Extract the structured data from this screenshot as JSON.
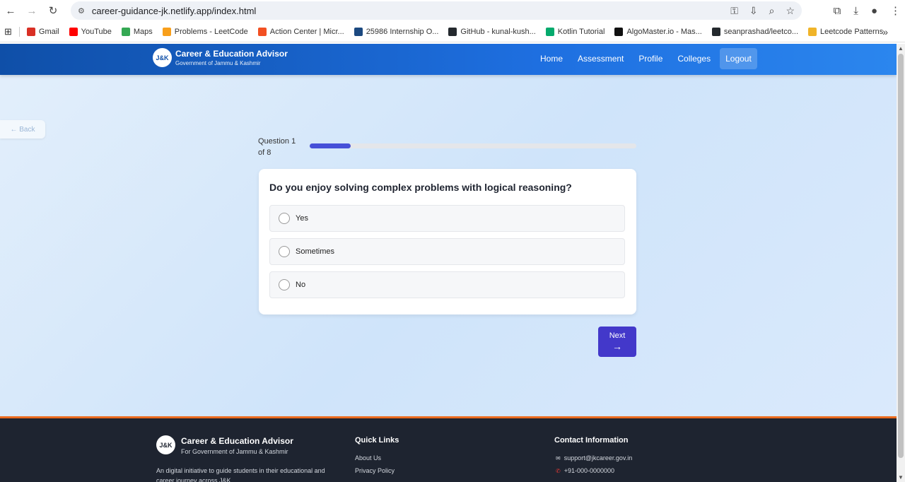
{
  "browser": {
    "url": "career-guidance-jk.netlify.app/index.html",
    "bookmarks": [
      {
        "label": "Gmail",
        "icon": "gmail-icon",
        "color": "#d93025"
      },
      {
        "label": "YouTube",
        "icon": "youtube-icon",
        "color": "#ff0000"
      },
      {
        "label": "Maps",
        "icon": "maps-icon",
        "color": "#34a853"
      },
      {
        "label": "Problems - LeetCode",
        "icon": "leetcode-icon",
        "color": "#f89f1b"
      },
      {
        "label": "Action Center | Micr...",
        "icon": "microsoft-icon",
        "color": "#f25022"
      },
      {
        "label": "25986 Internship O...",
        "icon": "unstop-icon",
        "color": "#1c4980"
      },
      {
        "label": "GitHub - kunal-kush...",
        "icon": "github-icon",
        "color": "#24292e"
      },
      {
        "label": "Kotlin Tutorial",
        "icon": "w3schools-icon",
        "color": "#04aa6d"
      },
      {
        "label": "AlgoMaster.io - Mas...",
        "icon": "algomaster-icon",
        "color": "#111111"
      },
      {
        "label": "seanprashad/leetco...",
        "icon": "github-icon",
        "color": "#24292e"
      },
      {
        "label": "Leetcode Patterns",
        "icon": "leetcode-patterns-icon",
        "color": "#f0b429"
      }
    ]
  },
  "header": {
    "logo_text": "J&K",
    "title": "Career & Education Advisor",
    "subtitle": "Government of Jammu & Kashmir",
    "nav": [
      "Home",
      "Assessment",
      "Profile",
      "Colleges",
      "Logout"
    ]
  },
  "back_label": "← Back",
  "quiz": {
    "progress_label": "Question 1 of 8",
    "progress_fraction": 0.125,
    "question": "Do you enjoy solving complex problems with logical reasoning?",
    "options": [
      "Yes",
      "Sometimes",
      "No"
    ],
    "next_label": "Next",
    "next_arrow": "→"
  },
  "footer": {
    "logo_text": "J&K",
    "title": "Career & Education Advisor",
    "subtitle": "For Government of Jammu & Kashmir",
    "description": "An digital initiative to guide students in their educational and career journey across J&K",
    "quick_links_title": "Quick Links",
    "quick_links": [
      "About Us",
      "Privacy Policy"
    ],
    "contact_title": "Contact Information",
    "email": "support@jkcareer.gov.in",
    "phone": "+91-000-0000000"
  },
  "colors": {
    "header_blue": "#1e6fe0",
    "accent_indigo": "#4338ca",
    "footer_bg": "#1e2430",
    "footer_accent": "#ea6a1e"
  }
}
